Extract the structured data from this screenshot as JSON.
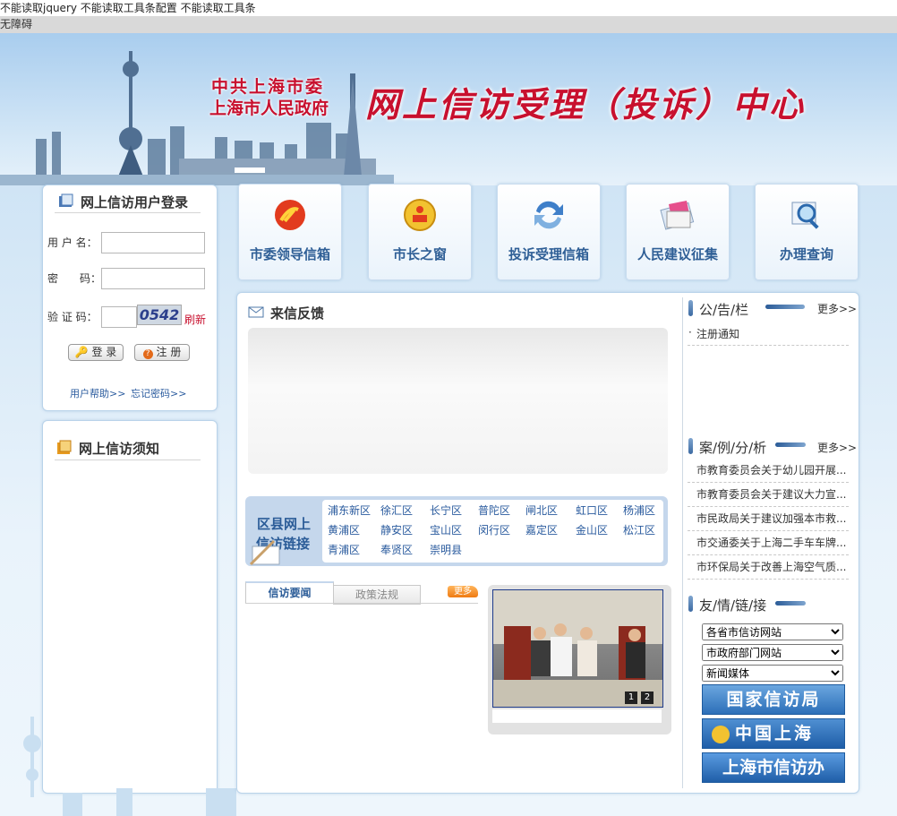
{
  "top_message": "不能读取jquery 不能读取工具条配置 不能读取工具条",
  "accessibility_label": "无障碍",
  "banner": {
    "party_committee": "中共上海市委",
    "municipal_gov": "上海市人民政府",
    "main_title": "网上信访受理（投诉）中心"
  },
  "login": {
    "title": "网上信访用户登录",
    "username_label": "用 户 名：",
    "password_label": "密　　码：",
    "captcha_label": "验 证 码：",
    "captcha_value": "0542",
    "refresh_label": "刷新",
    "login_button": "登 录",
    "register_button": "注 册",
    "help_link": "用户帮助>>",
    "forgot_link": "忘记密码>>"
  },
  "notice_box": {
    "title": "网上信访须知"
  },
  "nav": [
    {
      "label": "市委领导信箱",
      "icon": "party-emblem-icon"
    },
    {
      "label": "市长之窗",
      "icon": "national-emblem-icon"
    },
    {
      "label": "投诉受理信箱",
      "icon": "arrows-exchange-icon"
    },
    {
      "label": "人民建议征集",
      "icon": "envelope-mail-icon"
    },
    {
      "label": "办理查询",
      "icon": "magnifier-search-icon"
    }
  ],
  "feedback": {
    "title": "来信反馈"
  },
  "districts": {
    "title_line1": "区县网上",
    "title_line2": "信访链接",
    "items": [
      "浦东新区",
      "徐汇区",
      "长宁区",
      "普陀区",
      "闸北区",
      "虹口区",
      "杨浦区",
      "黄浦区",
      "静安区",
      "宝山区",
      "闵行区",
      "嘉定区",
      "金山区",
      "松江区",
      "青浦区",
      "奉贤区",
      "崇明县"
    ]
  },
  "news_tabs": {
    "tab1": "信访要闻",
    "tab2": "政策法规",
    "more": "更多"
  },
  "slideshow": {
    "pages": [
      "1",
      "2"
    ]
  },
  "announcements": {
    "title": "公/告/栏",
    "more": "更多>>",
    "items": [
      "注册通知"
    ]
  },
  "cases": {
    "title": "案/例/分/析",
    "more": "更多>>",
    "items": [
      "市教育委员会关于幼儿园开展...",
      "市教育委员会关于建议大力宣...",
      "市民政局关于建议加强本市救...",
      "市交通委关于上海二手车车牌...",
      "市环保局关于改善上海空气质..."
    ]
  },
  "links": {
    "title": "友/情/链/接",
    "selects": [
      "各省市信访网站",
      "市政府部门网站",
      "新闻媒体"
    ],
    "banners": [
      "国家信访局",
      "中国上海",
      "上海市信访办"
    ]
  },
  "colors": {
    "accent_red": "#c8102e",
    "link_blue": "#2a5b9e",
    "panel_border": "#b9d3ea"
  }
}
